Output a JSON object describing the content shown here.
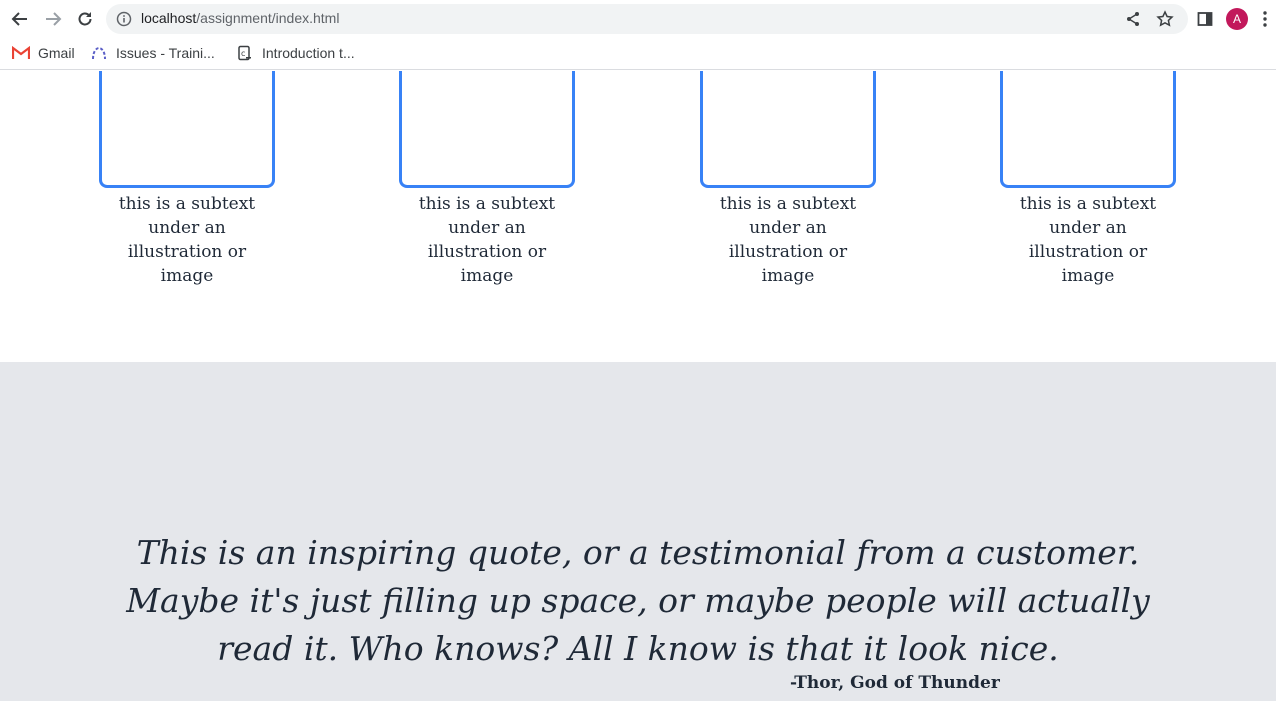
{
  "browser": {
    "url_host": "localhost",
    "url_path": "/assignment/index.html",
    "profile_initial": "A",
    "profile_color": "#c2185b"
  },
  "bookmarks": [
    {
      "label": "Gmail",
      "icon": "gmail-icon"
    },
    {
      "label": "Issues - Traini...",
      "icon": "issues-icon"
    },
    {
      "label": "Introduction t...",
      "icon": "document-icon"
    }
  ],
  "cards": [
    {
      "caption": "this is a subtext under an illustration or image"
    },
    {
      "caption": "this is a subtext under an illustration or image"
    },
    {
      "caption": "this is a subtext under an illustration or image"
    },
    {
      "caption": "this is a subtext under an illustration or image"
    }
  ],
  "quote": {
    "text": "This is an inspiring quote, or a testimonial from a customer. Maybe it's just filling up space, or maybe people will actually read it. Who knows? All I know is that it look nice.",
    "author": "-Thor, God of Thunder"
  },
  "colors": {
    "accent": "#3882f6",
    "quote_background": "#e5e7eb",
    "text": "#1f2937"
  }
}
